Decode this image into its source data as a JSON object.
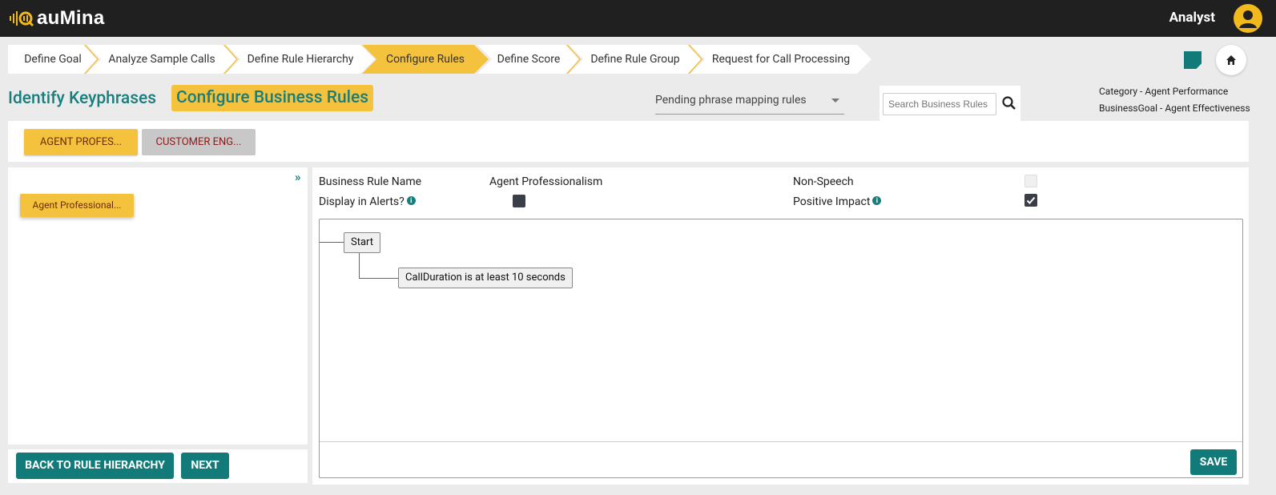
{
  "app": {
    "logo_text": "auMina",
    "user_role": "Analyst"
  },
  "steps": [
    {
      "label": "Define Goal",
      "active": false
    },
    {
      "label": "Analyze Sample Calls",
      "active": false
    },
    {
      "label": "Define Rule Hierarchy",
      "active": false
    },
    {
      "label": "Configure Rules",
      "active": true
    },
    {
      "label": "Define Score",
      "active": false
    },
    {
      "label": "Define Rule Group",
      "active": false
    },
    {
      "label": "Request for Call Processing",
      "active": false
    }
  ],
  "header": {
    "identify_keyphrases": "Identify Keyphrases",
    "configure_business_rules": "Configure Business Rules",
    "pending_select": "Pending phrase mapping rules",
    "search_placeholder": "Search Business Rules",
    "category": "Category - Agent Performance",
    "business_goal": "BusinessGoal - Agent Effectiveness"
  },
  "category_tabs": [
    {
      "label": "AGENT PROFES...",
      "active": true
    },
    {
      "label": "CUSTOMER ENG...",
      "active": false
    }
  ],
  "left_panel": {
    "collapse_icon": "double-chevron-right",
    "rules": [
      {
        "label": "Agent Professional..."
      }
    ],
    "back_button": "BACK TO RULE HIERARCHY",
    "next_button": "NEXT"
  },
  "rule_form": {
    "name_label": "Business Rule Name",
    "name_value": "Agent Professionalism",
    "non_speech_label": "Non-Speech",
    "non_speech_checked": false,
    "display_alerts_label": "Display in Alerts?",
    "display_alerts_checked": false,
    "positive_impact_label": "Positive Impact",
    "positive_impact_checked": true
  },
  "rule_tree": {
    "root": "Start",
    "children": [
      "CallDuration is at least 10 seconds"
    ]
  },
  "save_button": "SAVE",
  "colors": {
    "accent": "#f5c23e",
    "teal": "#127a78",
    "topbar": "#202020"
  }
}
